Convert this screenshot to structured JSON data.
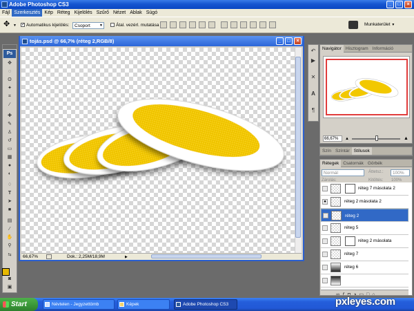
{
  "app": {
    "title": "Adobe Photoshop CS3"
  },
  "menu": [
    "Fájl",
    "Szerkesztés",
    "Kép",
    "Réteg",
    "Kijelölés",
    "Szűrő",
    "Nézet",
    "Ablak",
    "Súgó"
  ],
  "options": {
    "auto_select_label": "Automatikus kijelölés:",
    "auto_select_value": "Csoport",
    "transform_label": "Átal. vezérl. mutatása",
    "workspace_label": "Munkaterület"
  },
  "document": {
    "title": "tojás.psd @ 66,7% (réteg 2,RGB/8)",
    "zoom": "66,67%",
    "doc_size": "Dok.: 2,25M/18,9M"
  },
  "navigator": {
    "tabs": [
      "Navigátor",
      "Hisztogram",
      "Információ"
    ],
    "zoom": "66,67%"
  },
  "styles_panel": {
    "tabs": [
      "Szín",
      "Színtár",
      "Stílusok"
    ]
  },
  "layers_panel": {
    "tabs": [
      "Rétegek",
      "Csatornák",
      "Görbék"
    ],
    "blend_mode": "Normál",
    "opacity_label": "Áttetsz.:",
    "opacity_value": "100%",
    "lock_label": "Zárolás:",
    "fill_label": "Kitöltés:",
    "fill_value": "100%",
    "layers": [
      {
        "name": "réteg 7 másolata 2",
        "mask": true,
        "selected": false,
        "visible": false
      },
      {
        "name": "réteg 2 másolata 2",
        "mask": false,
        "selected": false,
        "visible": true
      },
      {
        "name": "réteg 2",
        "mask": false,
        "selected": true,
        "visible": false
      },
      {
        "name": "réteg 5",
        "mask": false,
        "selected": false,
        "visible": false
      },
      {
        "name": "réteg 2 másolata",
        "mask": true,
        "selected": false,
        "visible": false
      },
      {
        "name": "réteg 7",
        "mask": false,
        "selected": false,
        "visible": false
      },
      {
        "name": "réteg 6",
        "mask": false,
        "selected": false,
        "visible": false
      }
    ]
  },
  "taskbar": {
    "start": "Start",
    "items": [
      {
        "label": "Névtelen - Jegyzettömb",
        "active": false
      },
      {
        "label": "Képek",
        "active": false
      },
      {
        "label": "Adobe Photoshop CS3",
        "active": true
      }
    ]
  },
  "watermark": "pxleyes.com",
  "colors": {
    "title_blue": "#2c66d8",
    "egg_yellow": "#f2c800",
    "egg_white": "#ffffff",
    "selection_blue": "#3169c6",
    "foreground_color": "#e6b800"
  }
}
